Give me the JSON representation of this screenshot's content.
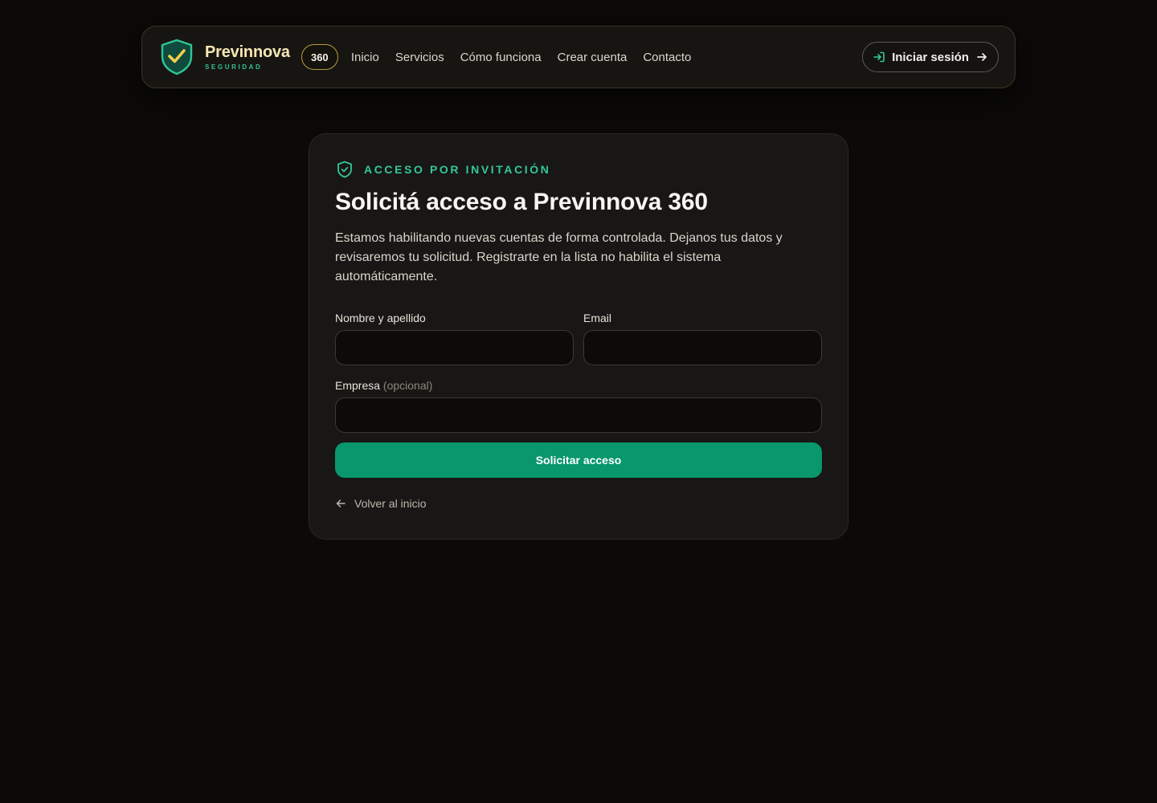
{
  "nav": {
    "brand_name": "Previnnova",
    "brand_sub": "SEGURIDAD",
    "badge": "360",
    "links": [
      "Inicio",
      "Servicios",
      "Cómo funciona",
      "Crear cuenta",
      "Contacto"
    ],
    "login_label": "Iniciar sesión"
  },
  "card": {
    "eyebrow": "ACCESO POR INVITACIÓN",
    "title": "Solicitá acceso a Previnnova 360",
    "description": "Estamos habilitando nuevas cuentas de forma controlada. Dejanos tus datos y revisaremos tu solicitud. Registrarte en la lista no habilita el sistema automáticamente.",
    "fields": {
      "name_label": "Nombre y apellido",
      "name_value": "",
      "email_label": "Email",
      "email_value": "",
      "company_label": "Empresa",
      "company_optional": "(opcional)",
      "company_value": ""
    },
    "submit_label": "Solicitar acceso",
    "back_label": "Volver al inicio"
  },
  "icons": {
    "logo": "shield-check-icon",
    "login": "log-in-icon",
    "arrow": "arrow-right-icon",
    "eyebrow": "shield-check-icon",
    "back": "arrow-left-icon"
  },
  "colors": {
    "accent_green": "#09976d",
    "eyebrow_green": "#34c79a",
    "brand_gold": "#f6e7b4",
    "background": "#0b0a08"
  }
}
